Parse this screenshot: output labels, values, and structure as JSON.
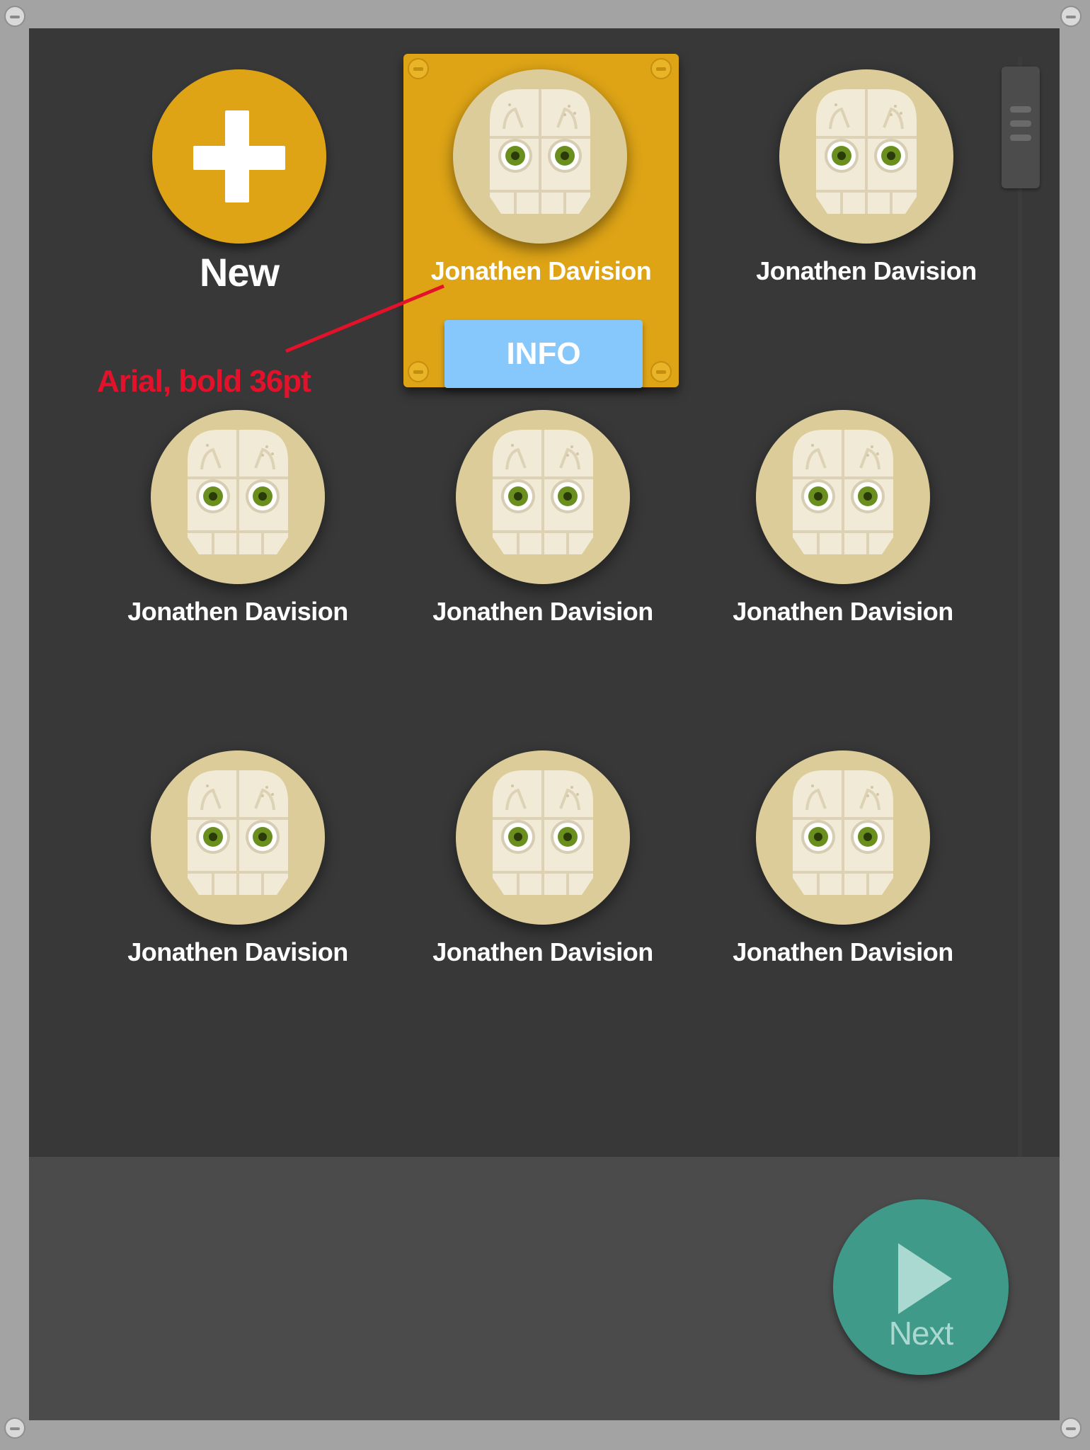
{
  "new_item": {
    "label": "New",
    "icon": "plus-icon"
  },
  "selected_item": {
    "name": "Jonathen Davision",
    "info_label": "INFO"
  },
  "annotation": {
    "text": "Arial, bold 36pt",
    "color": "#e3122a"
  },
  "profiles": [
    {
      "name": "Jonathen Davision"
    },
    {
      "name": "Jonathen Davision"
    },
    {
      "name": "Jonathen Davision"
    },
    {
      "name": "Jonathen Davision"
    },
    {
      "name": "Jonathen Davision"
    },
    {
      "name": "Jonathen Davision"
    },
    {
      "name": "Jonathen Davision"
    }
  ],
  "next_button": {
    "label": "Next",
    "icon": "play-icon"
  },
  "colors": {
    "accent": "#dea416",
    "info_button": "#86c8fc",
    "next_button": "#3f9a89",
    "background": "#383838",
    "footer": "#4b4b4b"
  }
}
